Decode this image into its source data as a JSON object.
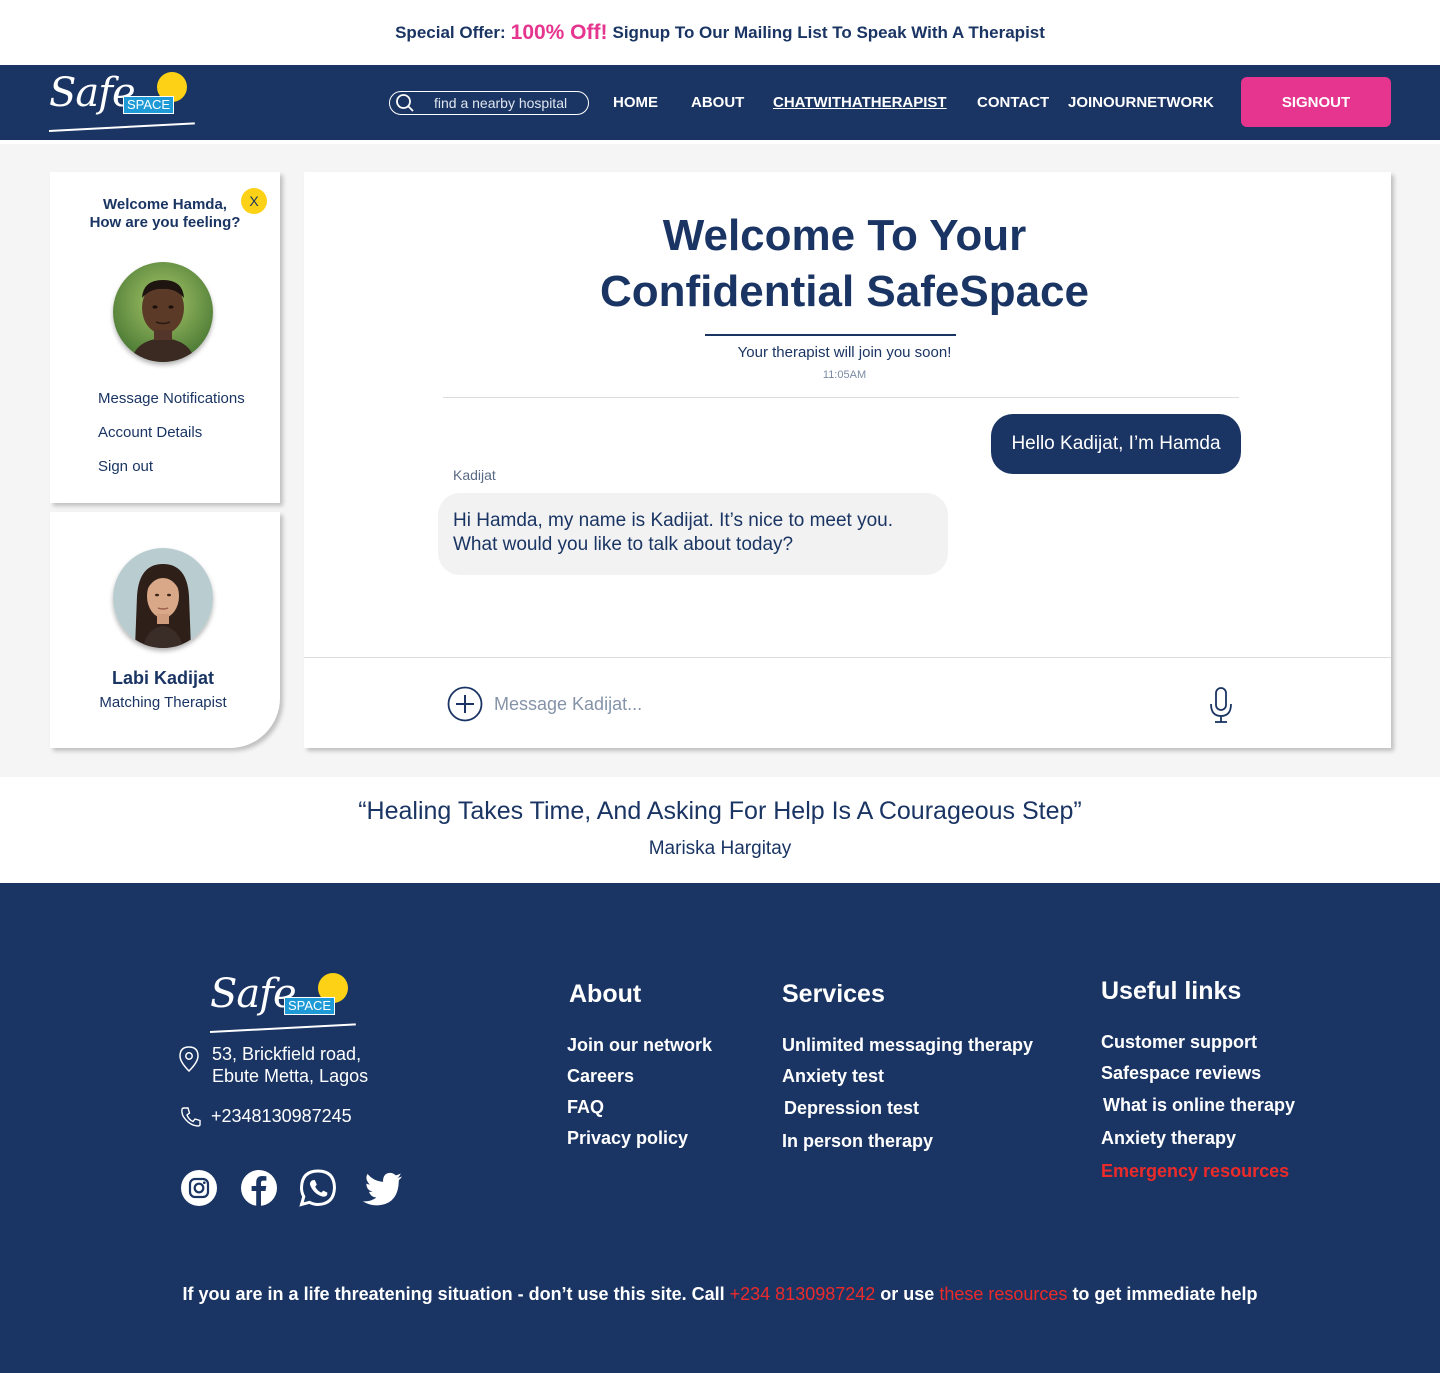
{
  "promo": {
    "lead": "Special Offer:",
    "highlight": "100% Off!",
    "tail": "Signup To Our Mailing List To Speak With A Therapist"
  },
  "logo": {
    "script": "Safe",
    "box": "SPACE"
  },
  "nav": {
    "search_placeholder": "find a nearby hospital",
    "links": [
      "HOME",
      "ABOUT",
      "CHATWITHATHERAPIST",
      "CONTACT",
      "JOINOURNETWORK"
    ],
    "signout": "SIGNOUT"
  },
  "profile": {
    "welcome_line1": "Welcome Hamda,",
    "welcome_line2": "How are you feeling?",
    "close": "X",
    "menu": [
      "Message Notifications",
      "Account Details",
      "Sign out"
    ]
  },
  "therapist": {
    "name": "Labi Kadijat",
    "role": "Matching Therapist"
  },
  "chat": {
    "title_line1": "Welcome To Your",
    "title_line2": "Confidential SafeSpace",
    "subtitle": "Your therapist will join you soon!",
    "time": "11:05AM",
    "outgoing": "Hello Kadijat, I’m Hamda",
    "sender": "Kadijat",
    "incoming_line1": "Hi Hamda, my name is Kadijat. It’s nice to meet you.",
    "incoming_line2": "What would you like to talk about today?",
    "input_placeholder": "Message Kadijat..."
  },
  "quote": {
    "text": "“Healing Takes Time, And Asking For Help Is A Courageous Step”",
    "author": "Mariska Hargitay"
  },
  "footer": {
    "address_line1": "53, Brickfield road,",
    "address_line2": "Ebute Metta, Lagos",
    "phone": "+2348130987245",
    "about": {
      "heading": "About",
      "links": [
        "Join our network",
        "Careers",
        "FAQ",
        "Privacy policy"
      ]
    },
    "services": {
      "heading": "Services",
      "links": [
        "Unlimited messaging therapy",
        "Anxiety test",
        "Depression test",
        "In person therapy"
      ]
    },
    "useful": {
      "heading": "Useful links",
      "links": [
        "Customer support",
        "Safespace reviews",
        "What is online therapy",
        "Anxiety therapy",
        "Emergency resources"
      ]
    },
    "disclaimer": {
      "part1": "If you are in a life threatening situation - don’t use this site. Call",
      "phone": "+234 8130987242",
      "part2": "or use",
      "link": "these resources",
      "part3": "to get immediate help"
    }
  },
  "colors": {
    "navy": "#1a3563",
    "pink": "#e5358f",
    "yellow": "#fcd116",
    "red": "#ec2a2a",
    "sky": "#1e9bd7"
  }
}
